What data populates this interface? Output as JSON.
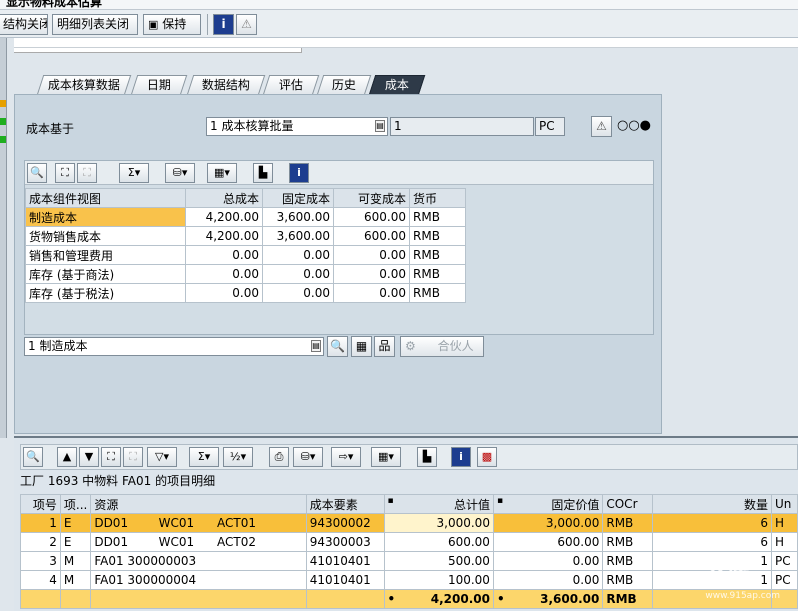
{
  "app": {
    "window_title": "显示物料成本估算"
  },
  "toolbar": {
    "structure_close": "结构关闭",
    "detail_close": "明细列表关闭",
    "keep": "保持"
  },
  "tabs": [
    {
      "label": "成本核算数据",
      "active": false
    },
    {
      "label": "日期",
      "active": false
    },
    {
      "label": "数据结构",
      "active": false
    },
    {
      "label": "评估",
      "active": false
    },
    {
      "label": "历史",
      "active": false
    },
    {
      "label": "成本",
      "active": true
    }
  ],
  "cost_base": {
    "label": "成本基于",
    "value": "1 成本核算批量",
    "qty": "1",
    "unit": "PC"
  },
  "component_view": {
    "headers": [
      "成本组件视图",
      "总成本",
      "固定成本",
      "可变成本",
      "货币"
    ],
    "rows": [
      [
        "制造成本",
        "4,200.00",
        "3,600.00",
        "600.00",
        "RMB"
      ],
      [
        "货物销售成本",
        "4,200.00",
        "3,600.00",
        "600.00",
        "RMB"
      ],
      [
        "销售和管理费用",
        "0.00",
        "0.00",
        "0.00",
        "RMB"
      ],
      [
        "库存 (基于商法)",
        "0.00",
        "0.00",
        "0.00",
        "RMB"
      ],
      [
        "库存 (基于税法)",
        "0.00",
        "0.00",
        "0.00",
        "RMB"
      ]
    ],
    "selected_row": 0
  },
  "view_select": {
    "value": "1 制造成本",
    "partner_button": "合伙人"
  },
  "itemization": {
    "title": "工厂 1693 中物料 FA01 的项目明细",
    "headers": [
      "项号",
      "项...",
      "资源",
      "成本要素",
      "总计值",
      "固定价值",
      "COCr",
      "数量",
      "Un"
    ],
    "rows": [
      [
        "1",
        "E",
        "DD01        WC01      ACT01",
        "94300002",
        "3,000.00",
        "3,000.00",
        "RMB",
        "6",
        "H"
      ],
      [
        "2",
        "E",
        "DD01        WC01      ACT02",
        "94300003",
        "600.00",
        "600.00",
        "RMB",
        "6",
        "H"
      ],
      [
        "3",
        "M",
        "FA01 300000003",
        "41010401",
        "500.00",
        "0.00",
        "RMB",
        "1",
        "PC"
      ],
      [
        "4",
        "M",
        "FA01 300000004",
        "41010401",
        "100.00",
        "0.00",
        "RMB",
        "1",
        "PC"
      ]
    ],
    "total": {
      "marker1": "•",
      "total_value": "4,200.00",
      "marker2": "•",
      "fixed_value": "3,600.00",
      "currency": "RMB"
    }
  },
  "watermark": {
    "text": "系统",
    "url": "www.915ap.com"
  },
  "colors": {
    "active_tab": "#2e3a48",
    "highlight": "#f8bf3a",
    "panel": "#c9d6e0"
  }
}
